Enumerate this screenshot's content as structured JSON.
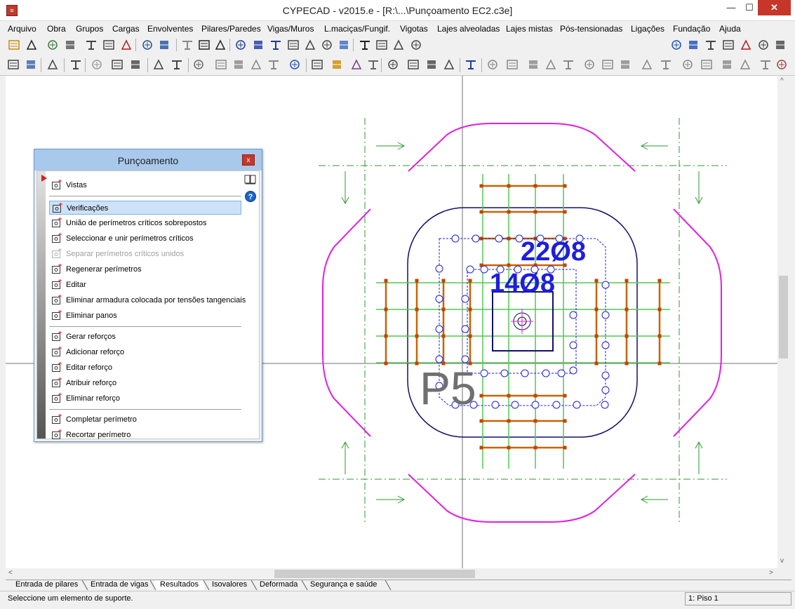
{
  "window": {
    "title": "CYPECAD - v2015.e - [R:\\...\\Punçoamento EC2.c3e]",
    "min": "—",
    "max": "☐",
    "close": "✕",
    "app_icon": "cype-logo-icon"
  },
  "menu": [
    "Arquivo",
    "Obra",
    "Grupos",
    "Cargas",
    "Envolventes",
    "Pilares/Paredes",
    "Vigas/Muros",
    "L.maciças/Fungif.",
    "Vigotas",
    "Lajes alveoladas",
    "Lajes mistas",
    "Pós-tensionadas",
    "Ligações",
    "Fundação",
    "Ajuda"
  ],
  "panel": {
    "title": "Punçoamento",
    "close": "x",
    "items": [
      {
        "label": "Vistas",
        "icon": "views-icon",
        "state": "normal"
      },
      {
        "label": "Verificações",
        "icon": "check-icon",
        "state": "selected"
      },
      {
        "label": "União de perímetros críticos sobrepostos",
        "icon": "merge-perimeters-icon",
        "state": "normal"
      },
      {
        "label": "Seleccionar e unir perímetros críticos",
        "icon": "select-merge-icon",
        "state": "normal"
      },
      {
        "label": "Separar perímetros críticos unidos",
        "icon": "split-perimeters-icon",
        "state": "disabled"
      },
      {
        "label": "Regenerar perímetros",
        "icon": "regenerate-icon",
        "state": "normal"
      },
      {
        "label": "Editar",
        "icon": "edit-icon",
        "state": "normal"
      },
      {
        "label": "Eliminar armadura colocada por tensões tangenciais",
        "icon": "delete-reinforcement-icon",
        "state": "normal"
      },
      {
        "label": "Eliminar panos",
        "icon": "delete-panels-icon",
        "state": "normal"
      },
      {
        "label": "Gerar reforços",
        "icon": "generate-reinforcement-icon",
        "state": "normal"
      },
      {
        "label": "Adicionar reforço",
        "icon": "add-reinforcement-icon",
        "state": "normal"
      },
      {
        "label": "Editar reforço",
        "icon": "edit-reinforcement-icon",
        "state": "normal"
      },
      {
        "label": "Atribuir reforço",
        "icon": "assign-reinforcement-icon",
        "state": "normal"
      },
      {
        "label": "Eliminar reforço",
        "icon": "remove-reinforcement-icon",
        "state": "normal"
      },
      {
        "label": "Completar perímetro",
        "icon": "complete-perimeter-icon",
        "state": "normal"
      },
      {
        "label": "Recortar perímetro",
        "icon": "trim-perimeter-icon",
        "state": "normal"
      }
    ],
    "side_icons": [
      "book-icon",
      "help-icon"
    ]
  },
  "drawing": {
    "column_label": "P5",
    "label_outer": "22Ø8",
    "label_inner": "14Ø8"
  },
  "tabs": [
    {
      "label": "Entrada de pilares",
      "active": false
    },
    {
      "label": "Entrada de vigas",
      "active": false
    },
    {
      "label": "Resultados",
      "active": true
    },
    {
      "label": "Isovalores",
      "active": false
    },
    {
      "label": "Deformada",
      "active": false
    },
    {
      "label": "Segurança e saúde",
      "active": false
    }
  ],
  "status": {
    "text": "Seleccione um elemento de suporte.",
    "floor": "1: Piso 1"
  },
  "scroll": {
    "left": "<",
    "right": ">",
    "up": "^",
    "down": "v"
  },
  "colors": {
    "magenta": "#e020e0",
    "navy": "#10106a",
    "blue": "#1e1edc",
    "green": "#2e9a2e",
    "orange": "#c86400",
    "bar_green": "#50c850",
    "panel_header": "#a9c9ec"
  }
}
